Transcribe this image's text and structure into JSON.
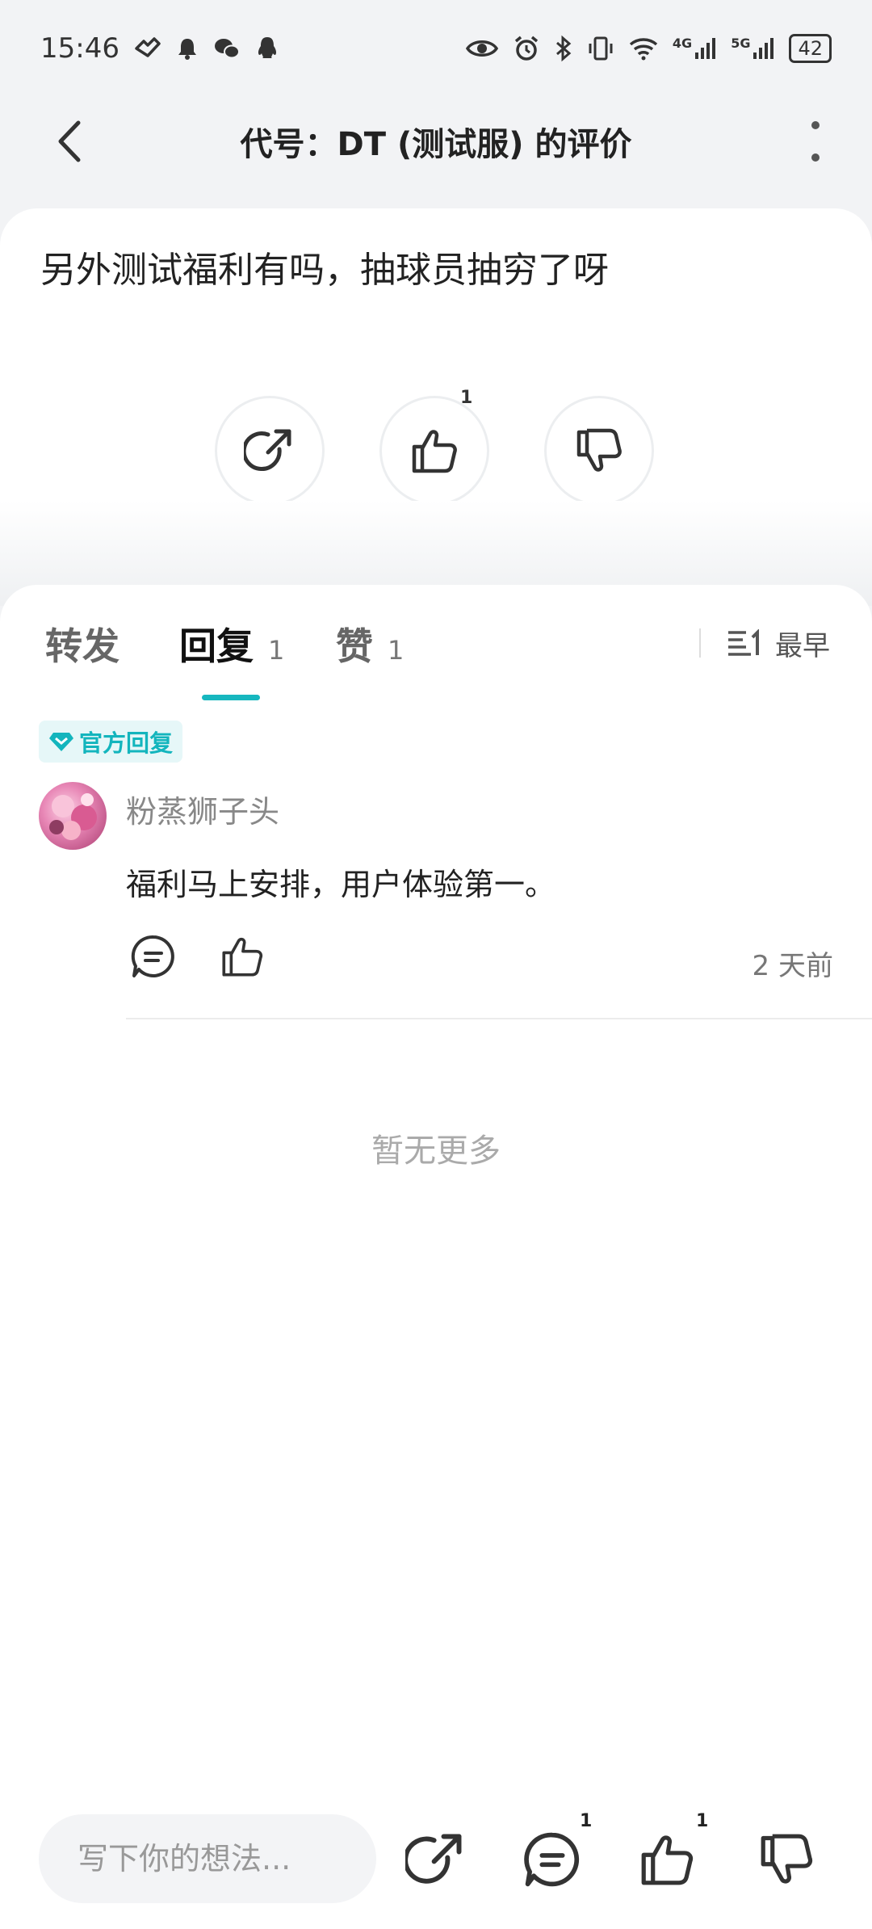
{
  "status_bar": {
    "time": "15:46",
    "battery": "42",
    "signal_4g": "4G",
    "signal_5g": "5G"
  },
  "header": {
    "title": "代号：DT (测试服) 的评价"
  },
  "review": {
    "text": "另外测试福利有吗，抽球员抽穷了呀",
    "like_count": "1"
  },
  "tabs": [
    {
      "label": "转发",
      "count": ""
    },
    {
      "label": "回复",
      "count": "1"
    },
    {
      "label": "赞",
      "count": "1"
    }
  ],
  "sort": {
    "label": "最早"
  },
  "comments": [
    {
      "badge": "官方回复",
      "username": "粉蒸狮子头",
      "text": "福利马上安排，用户体验第一。",
      "time": "2 天前"
    }
  ],
  "no_more_text": "暂无更多",
  "bottom_bar": {
    "input_placeholder": "写下你的想法...",
    "comment_count": "1",
    "like_count": "1"
  },
  "colors": {
    "accent": "#16b7bf",
    "background": "#f2f3f5"
  }
}
